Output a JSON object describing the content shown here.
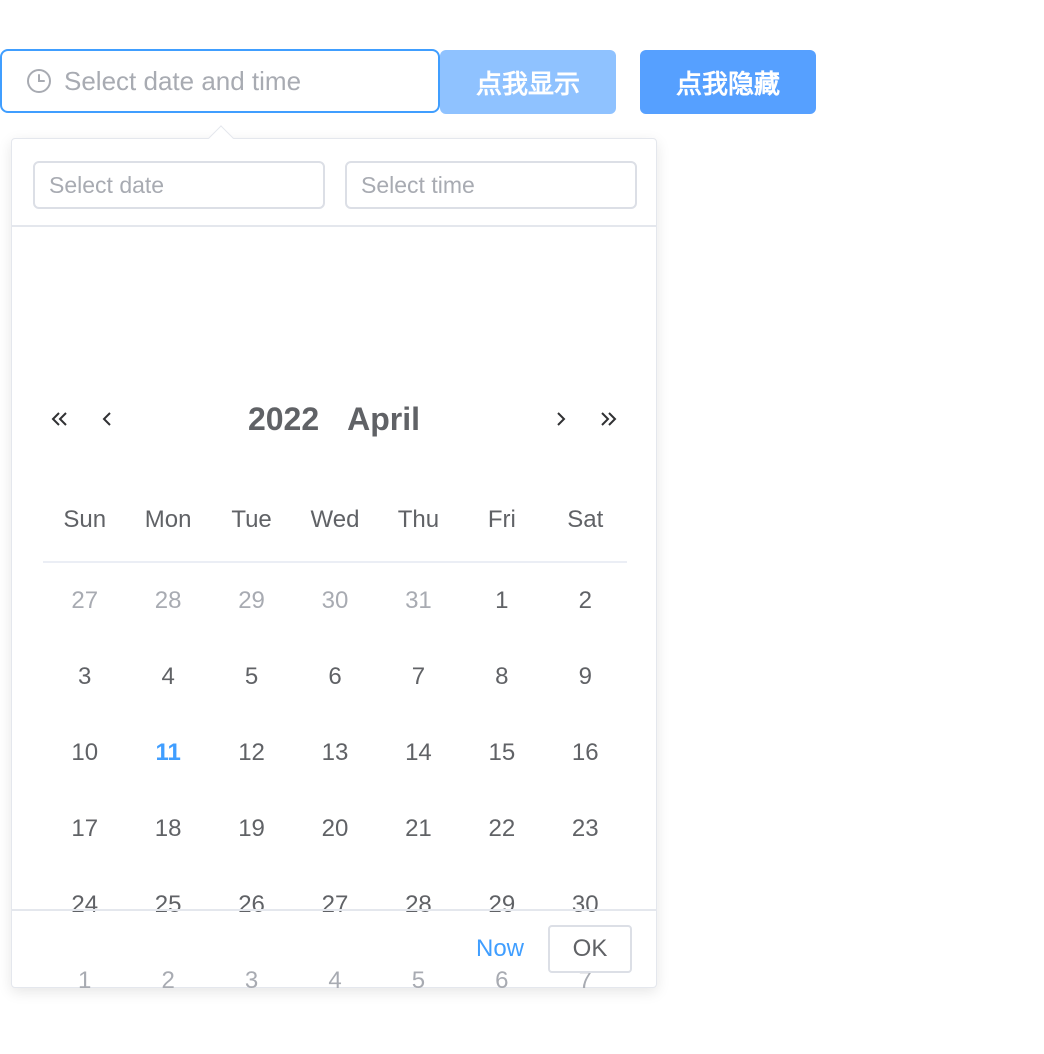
{
  "picker": {
    "placeholder": "Select date and time",
    "icon": "clock-icon"
  },
  "buttons": {
    "show_label": "点我显示",
    "hide_label": "点我隐藏"
  },
  "panel": {
    "date_placeholder": "Select date",
    "time_placeholder": "Select time",
    "year": "2022",
    "month": "April",
    "weekdays": [
      "Sun",
      "Mon",
      "Tue",
      "Wed",
      "Thu",
      "Fri",
      "Sat"
    ],
    "days": [
      {
        "d": "27",
        "t": "other"
      },
      {
        "d": "28",
        "t": "other"
      },
      {
        "d": "29",
        "t": "other"
      },
      {
        "d": "30",
        "t": "other"
      },
      {
        "d": "31",
        "t": "other"
      },
      {
        "d": "1",
        "t": ""
      },
      {
        "d": "2",
        "t": ""
      },
      {
        "d": "3",
        "t": ""
      },
      {
        "d": "4",
        "t": ""
      },
      {
        "d": "5",
        "t": ""
      },
      {
        "d": "6",
        "t": ""
      },
      {
        "d": "7",
        "t": ""
      },
      {
        "d": "8",
        "t": ""
      },
      {
        "d": "9",
        "t": ""
      },
      {
        "d": "10",
        "t": ""
      },
      {
        "d": "11",
        "t": "today"
      },
      {
        "d": "12",
        "t": ""
      },
      {
        "d": "13",
        "t": ""
      },
      {
        "d": "14",
        "t": ""
      },
      {
        "d": "15",
        "t": ""
      },
      {
        "d": "16",
        "t": ""
      },
      {
        "d": "17",
        "t": ""
      },
      {
        "d": "18",
        "t": ""
      },
      {
        "d": "19",
        "t": ""
      },
      {
        "d": "20",
        "t": ""
      },
      {
        "d": "21",
        "t": ""
      },
      {
        "d": "22",
        "t": ""
      },
      {
        "d": "23",
        "t": ""
      },
      {
        "d": "24",
        "t": ""
      },
      {
        "d": "25",
        "t": ""
      },
      {
        "d": "26",
        "t": ""
      },
      {
        "d": "27",
        "t": ""
      },
      {
        "d": "28",
        "t": ""
      },
      {
        "d": "29",
        "t": ""
      },
      {
        "d": "30",
        "t": ""
      },
      {
        "d": "1",
        "t": "other"
      },
      {
        "d": "2",
        "t": "other"
      },
      {
        "d": "3",
        "t": "other"
      },
      {
        "d": "4",
        "t": "other"
      },
      {
        "d": "5",
        "t": "other"
      },
      {
        "d": "6",
        "t": "other"
      },
      {
        "d": "7",
        "t": "other"
      }
    ],
    "now_label": "Now",
    "ok_label": "OK"
  },
  "colors": {
    "accent": "#409eff",
    "button_show": "#8fc2ff",
    "button_hide": "#56a0ff",
    "muted_text": "#a8abb2"
  }
}
